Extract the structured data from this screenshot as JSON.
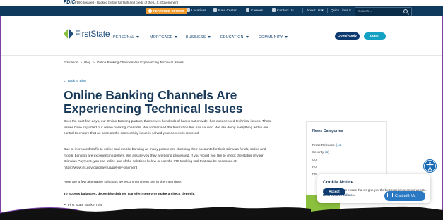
{
  "fdic": {
    "logo": "FDIC",
    "text": "FDIC-Insured - Backed by the full faith and credit of the U.S. Government"
  },
  "utility": {
    "featured": "FEATURED OFFERS",
    "locations": "Locations",
    "rate_center": "Rate Center",
    "careers": "Careers",
    "contact": "Contact Us",
    "about": "About Us",
    "quick_links": "Quick Links",
    "search_placeholder": "Search..."
  },
  "brand": {
    "name": "FirstState"
  },
  "nav": {
    "personal": "PERSONAL",
    "mortgage": "MORTGAGE",
    "business": "BUSINESS",
    "education": "EDUCATION",
    "community": "COMMUNITY",
    "open_apply": "Open/Apply",
    "login": "Login"
  },
  "breadcrumb": {
    "items": [
      "Education",
      "Blog",
      "Online Banking Channels Are Experiencing Technical Issues"
    ],
    "separator": ">"
  },
  "article": {
    "back": "Back to Blog",
    "title": "Online Banking Channels Are Experiencing Technical Issues",
    "p1": "Over the past few days, our Online Banking partner, that serves hundreds of banks nationwide, has experienced technical issues. These issues have impacted our online banking channels. We understand the frustration this has caused. We are doing everything within our control to ensure that as soon as the connectivity issue is solved your access is restored.",
    "p2": "Due to increased traffic to online and mobile banking as many people are checking their accounts for their stimulus funds, online and mobile banking are experiencing delays. We assure you they are being processed. If you would you like to check the status of your Stimulus Payment, you can utilize one of the solutions below or use the IRS tracking tool that can be accessed at: https://www.irs.gov/coronavirus/get-my-payment",
    "p3": "Here are a few alternative solutions we recommend you use in the meantime:",
    "p4": "To access balances, deposit/withdraw, transfer money or make a check deposit:",
    "list": [
      "First State Bank ATMs"
    ]
  },
  "sidebar": {
    "title": "News Categories",
    "rows": [
      {
        "label": "Press Releases",
        "count": "(44)"
      },
      {
        "label": "Security",
        "count": "(1)"
      },
      {
        "label": "Co",
        "count": ""
      },
      {
        "label": "Ho",
        "count": ""
      },
      {
        "label": "Fre",
        "count": ""
      }
    ]
  },
  "cookie": {
    "title": "Cookie Notice",
    "text": "We use cookies to ensure that we give you the best experience on our website.",
    "link": "Read cookies policies.",
    "accept": "Accept"
  },
  "chat": {
    "label": "Chat with Us"
  },
  "colors": {
    "navy": "#0f3a5e",
    "brand_blue": "#1c4b77",
    "orange": "#f39a2b",
    "teal": "#14a1c4",
    "green": "#8bbf3e",
    "purple_frame": "#7b3fa8"
  },
  "icons": [
    "star-icon",
    "location-pin-icon",
    "rate-center-icon",
    "careers-icon",
    "contact-icon",
    "search-icon",
    "caret-down-icon",
    "accessibility-icon",
    "chat-icon",
    "back-arrow-icon",
    "logo-mark-icon"
  ]
}
